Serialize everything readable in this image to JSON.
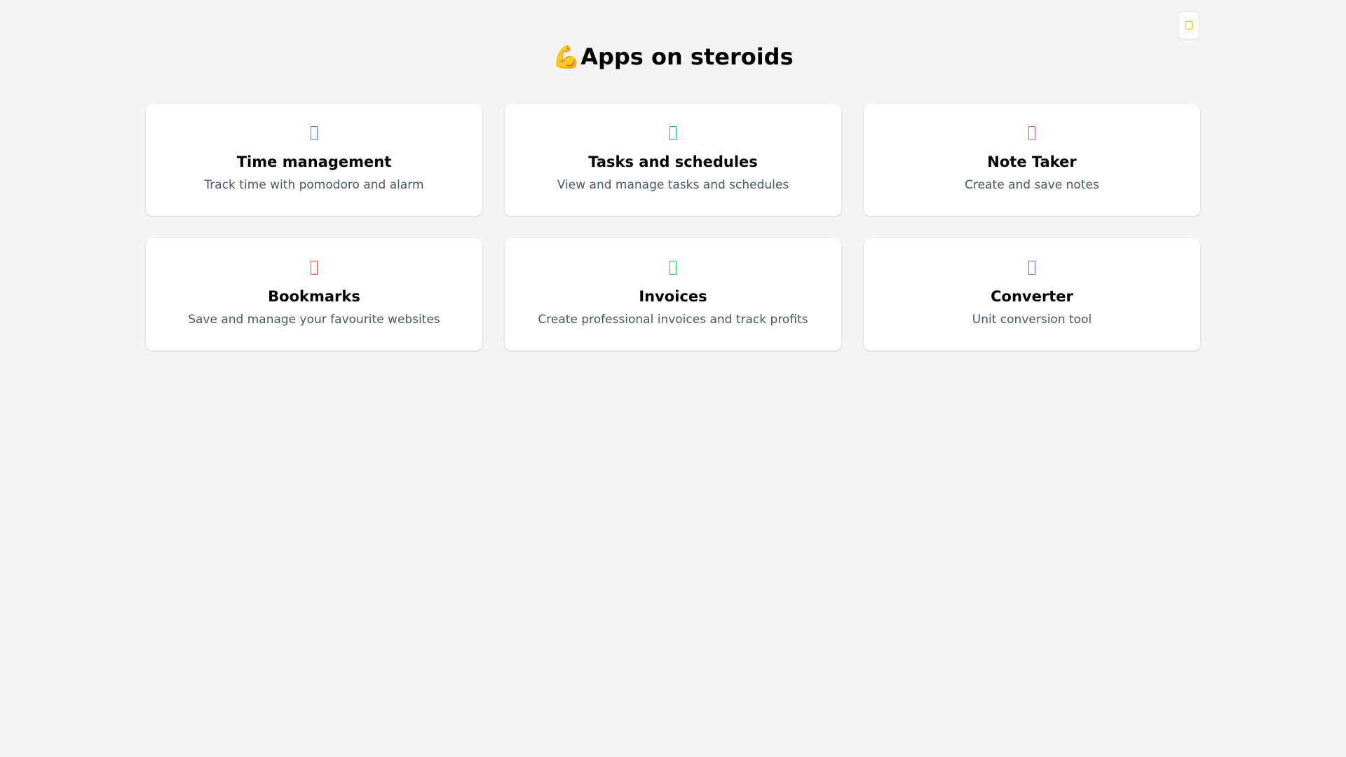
{
  "header": {
    "title": "💪Apps on steroids",
    "theme_toggle_icon": "sun-icon",
    "theme_toggle_color": "#f5b301"
  },
  "apps": [
    {
      "title": "Time management",
      "description": "Track time with pomodoro and alarm",
      "icon": "clock-icon",
      "color": "#3b82f6"
    },
    {
      "title": "Tasks and schedules",
      "description": "View and manage tasks and schedules",
      "icon": "tasks-icon",
      "color": "#10b981"
    },
    {
      "title": "Note Taker",
      "description": "Create and save notes",
      "icon": "note-icon",
      "color": "#a855f7"
    },
    {
      "title": "Bookmarks",
      "description": "Save and manage your favourite websites",
      "icon": "bookmark-icon",
      "color": "#ef4444"
    },
    {
      "title": "Invoices",
      "description": "Create professional invoices and track profits",
      "icon": "invoice-icon",
      "color": "#22c55e"
    },
    {
      "title": "Converter",
      "description": "Unit conversion tool",
      "icon": "converter-icon",
      "color": "#6366f1"
    }
  ]
}
